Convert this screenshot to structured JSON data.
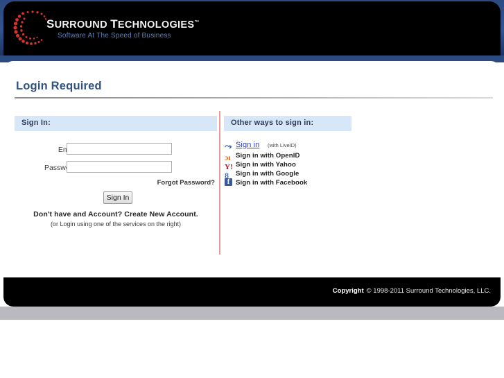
{
  "brand": {
    "name_part1": "S",
    "name_rest1": "URROUND ",
    "name_part2": "T",
    "name_rest2": "ECHNOLOGIES",
    "trademark": "™",
    "tagline": "Software At The Speed of Business",
    "logo_icon": "red-dotted-spiral-logo",
    "tagline_color": "#5b82c4",
    "name_color": "#f2f2f2"
  },
  "page": {
    "title": "Login Required",
    "title_color": "#31517f"
  },
  "signin_panel": {
    "heading": "Sign In:",
    "heading_bg": "#d7e7f8",
    "email_label": "Email:",
    "email_value": "",
    "email_placeholder": "",
    "password_label": "Password:",
    "password_value": "",
    "password_placeholder": "",
    "forgot_password_link": "Forgot Password?",
    "submit_label": "Sign In",
    "create_account_text": "Don't have and Account? Create New Account.",
    "hint_text": "(or Login using one of the services on the right)"
  },
  "other_signin_panel": {
    "heading": "Other ways to sign in:",
    "heading_bg": "#d7e7f8",
    "divider_color": "#f09a9a",
    "providers": [
      {
        "label": "Sign in",
        "note": "(with LiveID)",
        "icon": "windows-liveid-icon",
        "icon_glyph": "⤳",
        "icon_color": "#2f64c8"
      },
      {
        "label": "Sign in with OpenID",
        "note": "",
        "icon": "openid-icon",
        "icon_glyph": "ɔı",
        "icon_color": "#e66a1b"
      },
      {
        "label": "Sign in with Yahoo",
        "note": "",
        "icon": "yahoo-icon",
        "icon_glyph": "Y!",
        "icon_color": "#c4022c"
      },
      {
        "label": "Sign in with Google",
        "note": "",
        "icon": "google-icon",
        "icon_glyph": "8",
        "icon_color": "#4a6fbf"
      },
      {
        "label": "Sign in with Facebook",
        "note": "",
        "icon": "facebook-icon",
        "icon_glyph": "f",
        "icon_color": "#3b5998"
      }
    ]
  },
  "footer": {
    "copyright_word": "Copyright",
    "copyright_text": "© 1998-2011 Surround Technologies, LLC."
  }
}
